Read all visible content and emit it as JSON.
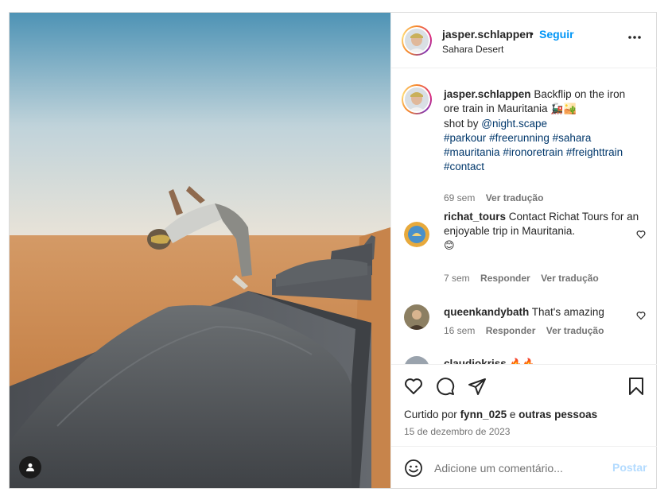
{
  "post": {
    "author": "jasper.schlappen",
    "follow_label": "Seguir",
    "separator": "•",
    "location": "Sahara Desert"
  },
  "caption": {
    "username": "jasper.schlappen",
    "text": "Backflip on the iron ore train in Mauritania",
    "emojis": "🚂🏜️",
    "credit_prefix": "shot by",
    "credit_handle": "@night.scape",
    "hashtags": [
      "#parkour",
      "#freerunning",
      "#sahara",
      "#mauritania",
      "#ironoretrain",
      "#freighttrain",
      "#contact"
    ],
    "time": "69 sem",
    "translate": "Ver tradução"
  },
  "comments": [
    {
      "username": "richat_tours",
      "text": "Contact Richat Tours for an enjoyable trip in Mauritania.",
      "emoji": "😊",
      "time": "7 sem",
      "reply": "Responder",
      "translate": "Ver tradução"
    },
    {
      "username": "queenkandybath",
      "text": "That's amazing",
      "time": "16 sem",
      "reply": "Responder",
      "translate": "Ver tradução"
    },
    {
      "username": "claudiokriss",
      "text": "🔥🔥"
    }
  ],
  "likes": {
    "prefix": "Curtido por",
    "user": "fynn_025",
    "joiner": "e",
    "others": "outras pessoas"
  },
  "date": "15 de dezembro de 2023",
  "add_comment": {
    "placeholder": "Adicione um comentário...",
    "post_label": "Postar"
  },
  "icons": {
    "more": "more-options-icon",
    "like": "heart-icon",
    "comment": "comment-icon",
    "share": "share-icon",
    "save": "bookmark-icon",
    "emoji": "emoji-icon",
    "user_tag": "user-tag-icon"
  },
  "colors": {
    "link": "#00376b",
    "follow": "#0095f6",
    "post_disabled": "#b3dbff",
    "meta": "#737373"
  }
}
